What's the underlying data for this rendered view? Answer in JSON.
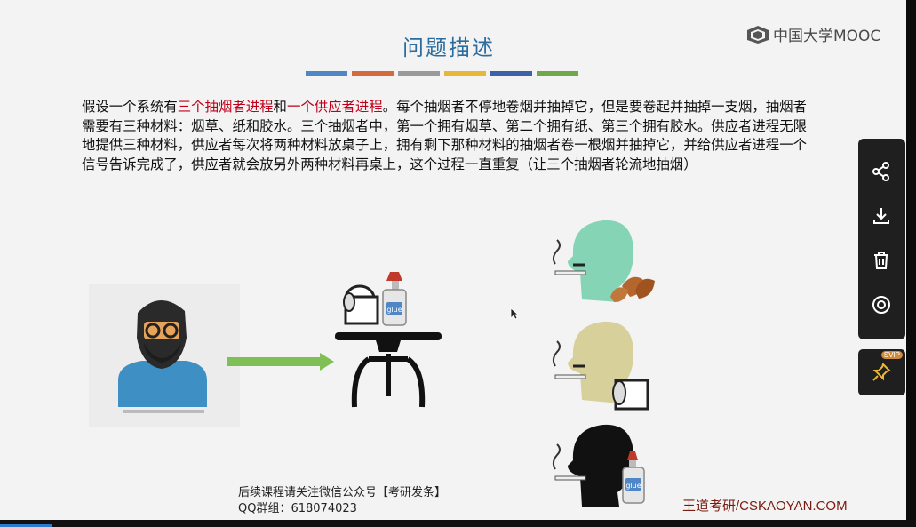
{
  "slide": {
    "title": "问题描述",
    "accent_bar_colors": [
      "#4f86c6",
      "#d36b3c",
      "#9a9a9a",
      "#e6b739",
      "#3c62a8",
      "#6fa84a"
    ],
    "paragraph": {
      "p1": "假设一个系统有",
      "h1": "三个抽烟者进程",
      "p2": "和",
      "h2": "一个供应者进程",
      "p3": "。每个抽烟者不停地卷烟并抽掉它，但是要卷起并抽掉一支烟，抽烟者需要有三种材料：烟草、纸和胶水。三个抽烟者中，第一个拥有烟草、第二个拥有纸、第三个拥有胶水。供应者进程无限地提供三种材料，供应者每次将两种材料放桌子上，拥有剩下那种材料的抽烟者卷一根烟并抽掉它，并给供应者进程一个信号告诉完成了，供应者就会放另外两种材料再桌上，这个过程一直重复（让三个抽烟者轮流地抽烟）"
    },
    "glue_label": "glue",
    "footer_line1": "后续课程请关注微信公众号【考研发条】",
    "footer_line2": "QQ群组：618074023",
    "brand": "王道考研/CSKAOYAN.COM"
  },
  "logo": {
    "text": "中国大学MOOC",
    "icon": "mooc-logo-icon"
  },
  "side_panel": {
    "buttons": [
      "share-icon",
      "download-icon",
      "trash-icon",
      "target-icon"
    ],
    "pin_badge": "SVIP"
  },
  "colors": {
    "title": "#2b6d9e",
    "highlight": "#c0001a",
    "brand": "#7a1a10"
  }
}
